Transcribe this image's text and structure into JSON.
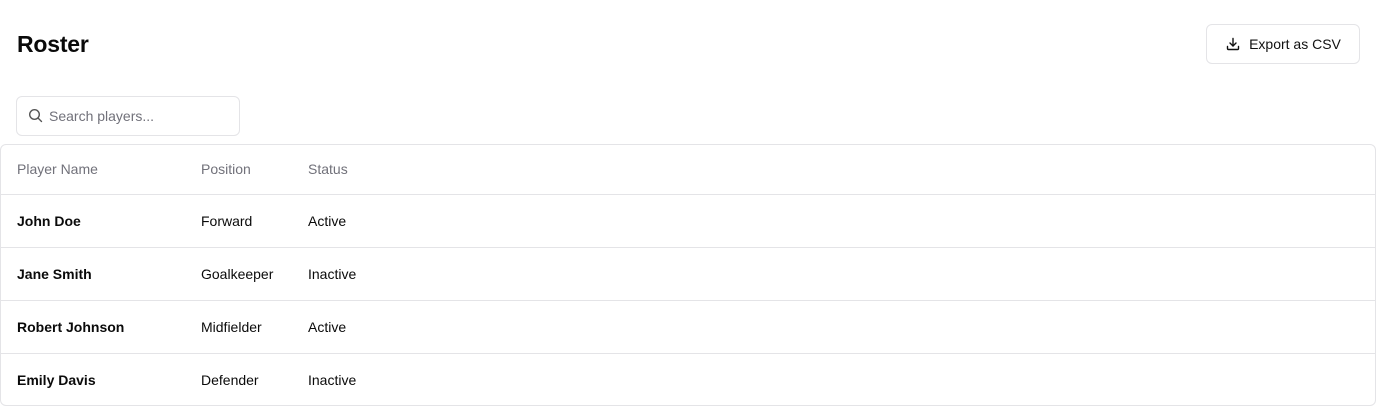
{
  "header": {
    "title": "Roster",
    "export_label": "Export as CSV",
    "export_icon": "download-icon"
  },
  "search": {
    "placeholder": "Search players...",
    "value": "",
    "icon": "search-icon"
  },
  "table": {
    "columns": [
      "Player Name",
      "Position",
      "Status"
    ],
    "rows": [
      {
        "name": "John Doe",
        "position": "Forward",
        "status": "Active"
      },
      {
        "name": "Jane Smith",
        "position": "Goalkeeper",
        "status": "Inactive"
      },
      {
        "name": "Robert Johnson",
        "position": "Midfielder",
        "status": "Active"
      },
      {
        "name": "Emily Davis",
        "position": "Defender",
        "status": "Inactive"
      }
    ]
  },
  "colors": {
    "border": "#e4e4e7",
    "muted_text": "#71717a",
    "text": "#0a0a0a"
  }
}
